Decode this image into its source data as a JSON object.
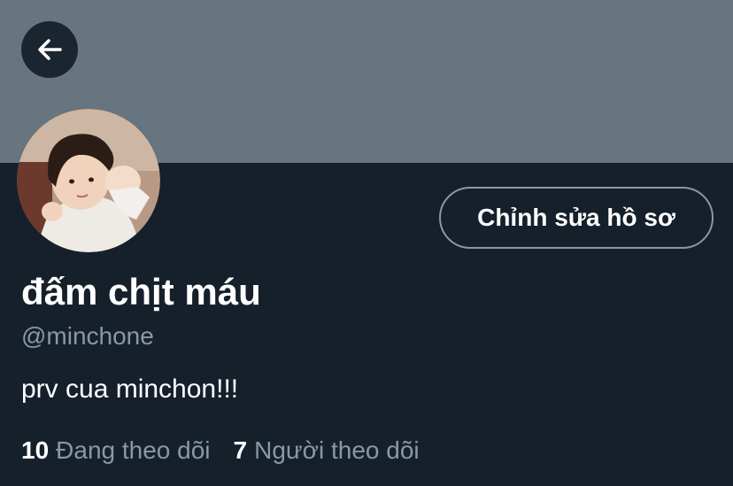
{
  "header": {
    "back_icon": "arrow-left-icon"
  },
  "profile": {
    "display_name": "đấm chịt máu",
    "handle": "@minchone",
    "bio": "prv cua minchon!!!",
    "edit_label": "Chỉnh sửa hồ sơ",
    "avatar": "child-photo-avatar"
  },
  "stats": {
    "following_count": "10",
    "following_label": "Đang theo dõi",
    "followers_count": "7",
    "followers_label": "Người theo dõi"
  },
  "colors": {
    "background": "#15202b",
    "banner": "#66757f",
    "secondary_text": "#8899a6",
    "button_border": "#8b98a5"
  }
}
